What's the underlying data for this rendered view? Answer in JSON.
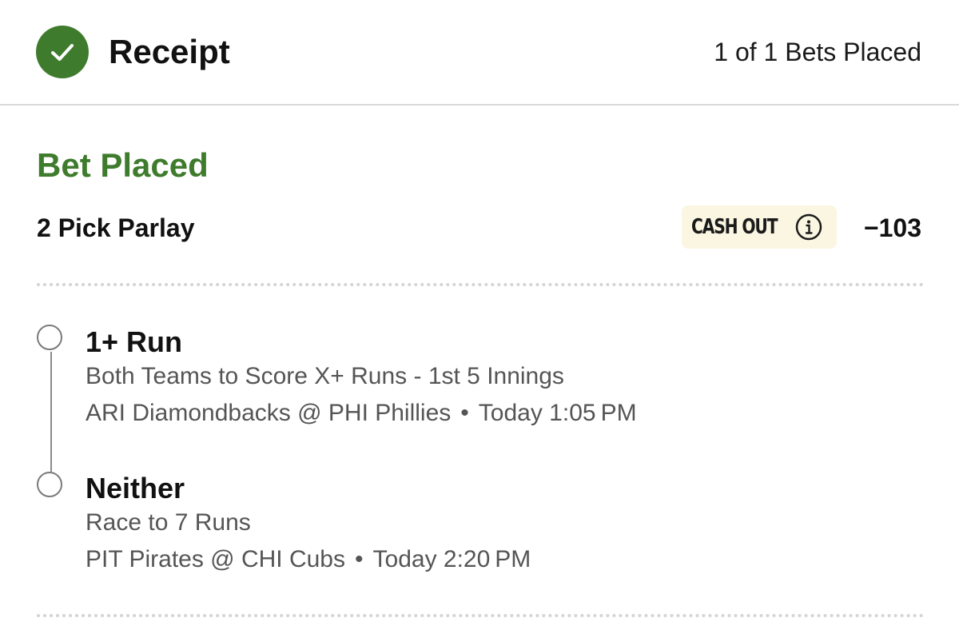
{
  "header": {
    "title": "Receipt",
    "bets_count": "1 of 1 Bets Placed",
    "icon": "check-circle-icon"
  },
  "bet": {
    "status": "Bet Placed",
    "type": "2 Pick Parlay",
    "cashout_label": "CASH OUT",
    "info_icon": "info-icon",
    "odds": "−103"
  },
  "legs": [
    {
      "pick": "1+ Run",
      "market": "Both Teams to Score X+ Runs - 1st 5 Innings",
      "matchup": "ARI Diamondbacks @ PHI Phillies",
      "separator": "•",
      "time": "Today 1:05 PM"
    },
    {
      "pick": "Neither",
      "market": "Race to 7 Runs",
      "matchup": "PIT Pirates @ CHI Cubs",
      "separator": "•",
      "time": "Today 2:20 PM"
    }
  ],
  "colors": {
    "success_green": "#3e7b2c",
    "cashout_bg": "#fbf6e2",
    "muted_text": "#555555",
    "divider": "#d4d4d4"
  }
}
